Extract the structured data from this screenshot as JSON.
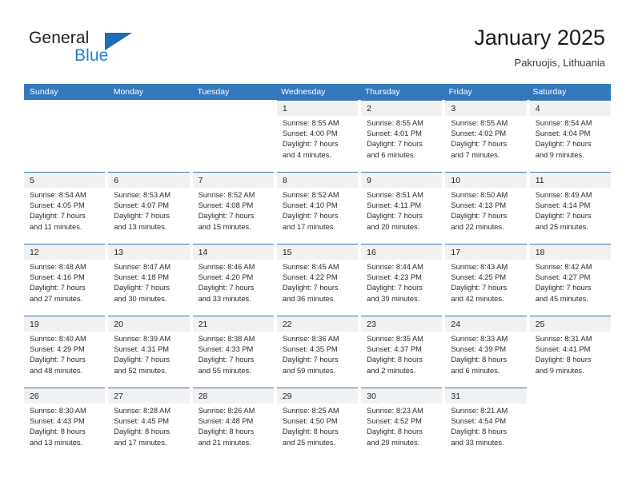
{
  "brand": {
    "name_top": "General",
    "name_bottom": "Blue",
    "triangle_color": "#1e6cb5",
    "blue_text_color": "#1f7fd0"
  },
  "header": {
    "title": "January 2025",
    "subtitle": "Pakruojis, Lithuania"
  },
  "theme": {
    "header_band": "#3478bc",
    "day_head_bg": "#f1f1f1",
    "row_top_rule": "#3478bc",
    "text": "#2b2b2b"
  },
  "weekdays": [
    "Sunday",
    "Monday",
    "Tuesday",
    "Wednesday",
    "Thursday",
    "Friday",
    "Saturday"
  ],
  "weeks": [
    [
      {
        "empty": true
      },
      {
        "empty": true
      },
      {
        "empty": true
      },
      {
        "day": "1",
        "sunrise": "Sunrise: 8:55 AM",
        "sunset": "Sunset: 4:00 PM",
        "daylight_1": "Daylight: 7 hours",
        "daylight_2": "and 4 minutes."
      },
      {
        "day": "2",
        "sunrise": "Sunrise: 8:55 AM",
        "sunset": "Sunset: 4:01 PM",
        "daylight_1": "Daylight: 7 hours",
        "daylight_2": "and 6 minutes."
      },
      {
        "day": "3",
        "sunrise": "Sunrise: 8:55 AM",
        "sunset": "Sunset: 4:02 PM",
        "daylight_1": "Daylight: 7 hours",
        "daylight_2": "and 7 minutes."
      },
      {
        "day": "4",
        "sunrise": "Sunrise: 8:54 AM",
        "sunset": "Sunset: 4:04 PM",
        "daylight_1": "Daylight: 7 hours",
        "daylight_2": "and 9 minutes."
      }
    ],
    [
      {
        "day": "5",
        "sunrise": "Sunrise: 8:54 AM",
        "sunset": "Sunset: 4:05 PM",
        "daylight_1": "Daylight: 7 hours",
        "daylight_2": "and 11 minutes."
      },
      {
        "day": "6",
        "sunrise": "Sunrise: 8:53 AM",
        "sunset": "Sunset: 4:07 PM",
        "daylight_1": "Daylight: 7 hours",
        "daylight_2": "and 13 minutes."
      },
      {
        "day": "7",
        "sunrise": "Sunrise: 8:52 AM",
        "sunset": "Sunset: 4:08 PM",
        "daylight_1": "Daylight: 7 hours",
        "daylight_2": "and 15 minutes."
      },
      {
        "day": "8",
        "sunrise": "Sunrise: 8:52 AM",
        "sunset": "Sunset: 4:10 PM",
        "daylight_1": "Daylight: 7 hours",
        "daylight_2": "and 17 minutes."
      },
      {
        "day": "9",
        "sunrise": "Sunrise: 8:51 AM",
        "sunset": "Sunset: 4:11 PM",
        "daylight_1": "Daylight: 7 hours",
        "daylight_2": "and 20 minutes."
      },
      {
        "day": "10",
        "sunrise": "Sunrise: 8:50 AM",
        "sunset": "Sunset: 4:13 PM",
        "daylight_1": "Daylight: 7 hours",
        "daylight_2": "and 22 minutes."
      },
      {
        "day": "11",
        "sunrise": "Sunrise: 8:49 AM",
        "sunset": "Sunset: 4:14 PM",
        "daylight_1": "Daylight: 7 hours",
        "daylight_2": "and 25 minutes."
      }
    ],
    [
      {
        "day": "12",
        "sunrise": "Sunrise: 8:48 AM",
        "sunset": "Sunset: 4:16 PM",
        "daylight_1": "Daylight: 7 hours",
        "daylight_2": "and 27 minutes."
      },
      {
        "day": "13",
        "sunrise": "Sunrise: 8:47 AM",
        "sunset": "Sunset: 4:18 PM",
        "daylight_1": "Daylight: 7 hours",
        "daylight_2": "and 30 minutes."
      },
      {
        "day": "14",
        "sunrise": "Sunrise: 8:46 AM",
        "sunset": "Sunset: 4:20 PM",
        "daylight_1": "Daylight: 7 hours",
        "daylight_2": "and 33 minutes."
      },
      {
        "day": "15",
        "sunrise": "Sunrise: 8:45 AM",
        "sunset": "Sunset: 4:22 PM",
        "daylight_1": "Daylight: 7 hours",
        "daylight_2": "and 36 minutes."
      },
      {
        "day": "16",
        "sunrise": "Sunrise: 8:44 AM",
        "sunset": "Sunset: 4:23 PM",
        "daylight_1": "Daylight: 7 hours",
        "daylight_2": "and 39 minutes."
      },
      {
        "day": "17",
        "sunrise": "Sunrise: 8:43 AM",
        "sunset": "Sunset: 4:25 PM",
        "daylight_1": "Daylight: 7 hours",
        "daylight_2": "and 42 minutes."
      },
      {
        "day": "18",
        "sunrise": "Sunrise: 8:42 AM",
        "sunset": "Sunset: 4:27 PM",
        "daylight_1": "Daylight: 7 hours",
        "daylight_2": "and 45 minutes."
      }
    ],
    [
      {
        "day": "19",
        "sunrise": "Sunrise: 8:40 AM",
        "sunset": "Sunset: 4:29 PM",
        "daylight_1": "Daylight: 7 hours",
        "daylight_2": "and 48 minutes."
      },
      {
        "day": "20",
        "sunrise": "Sunrise: 8:39 AM",
        "sunset": "Sunset: 4:31 PM",
        "daylight_1": "Daylight: 7 hours",
        "daylight_2": "and 52 minutes."
      },
      {
        "day": "21",
        "sunrise": "Sunrise: 8:38 AM",
        "sunset": "Sunset: 4:33 PM",
        "daylight_1": "Daylight: 7 hours",
        "daylight_2": "and 55 minutes."
      },
      {
        "day": "22",
        "sunrise": "Sunrise: 8:36 AM",
        "sunset": "Sunset: 4:35 PM",
        "daylight_1": "Daylight: 7 hours",
        "daylight_2": "and 59 minutes."
      },
      {
        "day": "23",
        "sunrise": "Sunrise: 8:35 AM",
        "sunset": "Sunset: 4:37 PM",
        "daylight_1": "Daylight: 8 hours",
        "daylight_2": "and 2 minutes."
      },
      {
        "day": "24",
        "sunrise": "Sunrise: 8:33 AM",
        "sunset": "Sunset: 4:39 PM",
        "daylight_1": "Daylight: 8 hours",
        "daylight_2": "and 6 minutes."
      },
      {
        "day": "25",
        "sunrise": "Sunrise: 8:31 AM",
        "sunset": "Sunset: 4:41 PM",
        "daylight_1": "Daylight: 8 hours",
        "daylight_2": "and 9 minutes."
      }
    ],
    [
      {
        "day": "26",
        "sunrise": "Sunrise: 8:30 AM",
        "sunset": "Sunset: 4:43 PM",
        "daylight_1": "Daylight: 8 hours",
        "daylight_2": "and 13 minutes."
      },
      {
        "day": "27",
        "sunrise": "Sunrise: 8:28 AM",
        "sunset": "Sunset: 4:45 PM",
        "daylight_1": "Daylight: 8 hours",
        "daylight_2": "and 17 minutes."
      },
      {
        "day": "28",
        "sunrise": "Sunrise: 8:26 AM",
        "sunset": "Sunset: 4:48 PM",
        "daylight_1": "Daylight: 8 hours",
        "daylight_2": "and 21 minutes."
      },
      {
        "day": "29",
        "sunrise": "Sunrise: 8:25 AM",
        "sunset": "Sunset: 4:50 PM",
        "daylight_1": "Daylight: 8 hours",
        "daylight_2": "and 25 minutes."
      },
      {
        "day": "30",
        "sunrise": "Sunrise: 8:23 AM",
        "sunset": "Sunset: 4:52 PM",
        "daylight_1": "Daylight: 8 hours",
        "daylight_2": "and 29 minutes."
      },
      {
        "day": "31",
        "sunrise": "Sunrise: 8:21 AM",
        "sunset": "Sunset: 4:54 PM",
        "daylight_1": "Daylight: 8 hours",
        "daylight_2": "and 33 minutes."
      },
      {
        "empty": true
      }
    ]
  ]
}
